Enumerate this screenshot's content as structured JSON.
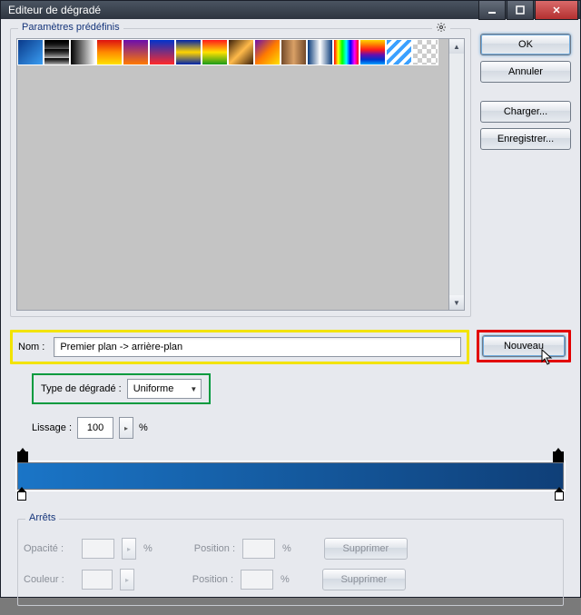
{
  "window": {
    "title": "Editeur de dégradé"
  },
  "buttons": {
    "ok": "OK",
    "cancel": "Annuler",
    "load": "Charger...",
    "save": "Enregistrer...",
    "new": "Nouveau",
    "delete": "Supprimer"
  },
  "presets": {
    "legend": "Paramètres prédéfinis",
    "swatches": [
      {
        "css": "linear-gradient(135deg,#0a3a8a,#3a9df2)"
      },
      {
        "css": "checker-overlay",
        "overlay": "linear-gradient(to bottom,#000,rgba(0,0,0,0))"
      },
      {
        "css": "linear-gradient(to right,#000,#fff)"
      },
      {
        "css": "linear-gradient(to bottom,#d11,#ff8a00,#ffe100)"
      },
      {
        "css": "linear-gradient(to bottom,#6a0dad,#ff7a00)"
      },
      {
        "css": "linear-gradient(to bottom,#0033cc,#ff2a2a)"
      },
      {
        "css": "linear-gradient(to bottom,#0022aa,#ffd400,#0022aa)"
      },
      {
        "css": "linear-gradient(to bottom,#ff1a1a,#ffe100,#1a9a1a)"
      },
      {
        "css": "linear-gradient(135deg,#3a1f0a,#ffba4a,#3a1f0a)"
      },
      {
        "css": "linear-gradient(135deg,#6a0dad,#ff7a00,#ffe100)"
      },
      {
        "css": "linear-gradient(to right,#734a2a,#d9a066,#734a2a)"
      },
      {
        "css": "linear-gradient(to right,#083a7a,#ffffff,#083a7a)"
      },
      {
        "css": "linear-gradient(to right,#ff0000,#ffff00,#00ff00,#00ffff,#0000ff,#ff00ff,#ff0000)"
      },
      {
        "css": "linear-gradient(to bottom,#ffd400,#ff7a00,#ff1a1a,#6a0dad,#0033cc,#00a2ff)"
      },
      {
        "css": "repeating-linear-gradient(135deg,#3aa0ff 0 4px,#fff 4px 8px)"
      },
      {
        "css": "checker"
      }
    ]
  },
  "name": {
    "label": "Nom :",
    "value": "Premier plan -> arrière-plan"
  },
  "type": {
    "label": "Type de dégradé :",
    "value": "Uniforme"
  },
  "smoothing": {
    "label": "Lissage :",
    "value": "100",
    "unit": "%"
  },
  "stops": {
    "legend": "Arrêts",
    "opacity_label": "Opacité :",
    "color_label": "Couleur :",
    "position_label": "Position :",
    "unit": "%"
  }
}
